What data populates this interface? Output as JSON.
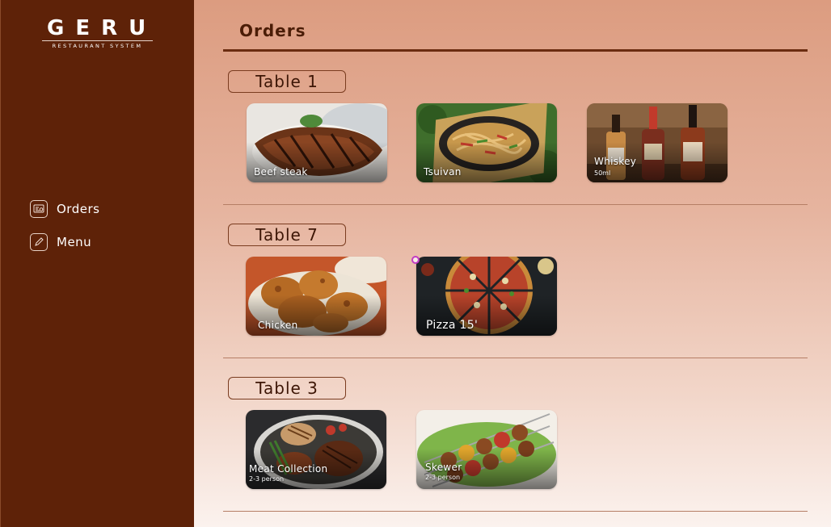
{
  "brand": {
    "name": "GERU",
    "tagline": "RESTAURANT SYSTEM"
  },
  "nav": [
    {
      "label": "Orders",
      "icon": "orders-icon"
    },
    {
      "label": "Menu",
      "icon": "edit-pen-icon"
    }
  ],
  "page": {
    "title": "Orders"
  },
  "tables": [
    {
      "label": "Table 1",
      "items": [
        {
          "name": "Beef steak",
          "sub": "",
          "image": "beef-steak-image"
        },
        {
          "name": "Tsuivan",
          "sub": "",
          "image": "tsuivan-image"
        },
        {
          "name": "Whiskey",
          "sub": "50ml",
          "image": "whiskey-bottles-image"
        }
      ]
    },
    {
      "label": "Table 7",
      "items": [
        {
          "name": "Chicken",
          "sub": "",
          "image": "fried-chicken-image"
        },
        {
          "name": "Pizza 15'",
          "sub": "",
          "image": "pizza-image"
        }
      ]
    },
    {
      "label": "Table 3",
      "items": [
        {
          "name": "Meat Collection",
          "sub": "2-3 person",
          "image": "meat-collection-image"
        },
        {
          "name": "Skewer",
          "sub": "2-3 person",
          "image": "skewer-image"
        }
      ]
    }
  ],
  "colors": {
    "sidebar": "#5e2208",
    "accent": "#6b2c10",
    "text_dark": "#3d1606"
  }
}
